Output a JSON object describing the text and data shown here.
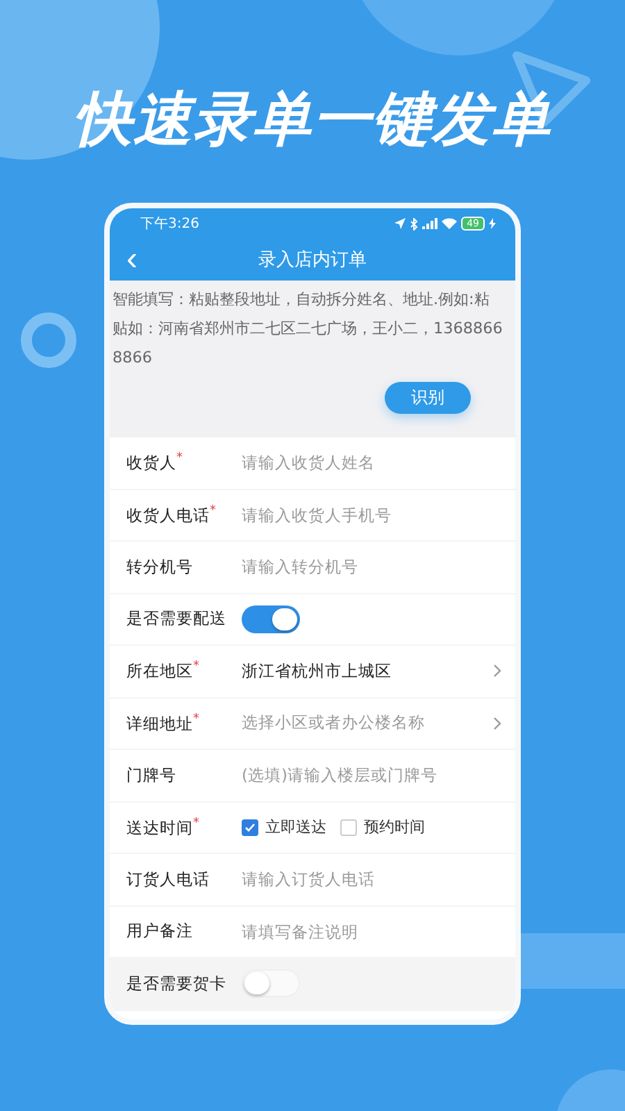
{
  "headline": "快速录单一键发单",
  "status_bar": {
    "time": "下午3:26",
    "battery": "49"
  },
  "nav": {
    "back": "‹",
    "title": "录入店内订单"
  },
  "smart_fill": {
    "text": "智能填写：粘贴整段地址，自动拆分姓名、地址.例如:粘贴如：河南省郑州市二七区二七广场，王小二，13688668866",
    "button": "识别"
  },
  "form": [
    {
      "kind": "input",
      "label": "收货人$^{*}$",
      "placeholder": "请输入收货人姓名"
    },
    {
      "kind": "input",
      "label": "收货人电话$^{*}$",
      "placeholder": "请输入收货人手机号"
    },
    {
      "kind": "input",
      "label": "转分机号",
      "placeholder": "请输入转分机号"
    },
    {
      "kind": "toggle",
      "label": "是否需要配送",
      "on": true
    },
    {
      "kind": "select",
      "label": "所在地区$^{*}$",
      "value": "浙江省杭州市上城区"
    },
    {
      "kind": "select",
      "label": "详细地址$^{*}$",
      "placeholder": "选择小区或者办公楼名称"
    },
    {
      "kind": "input",
      "label": "门牌号",
      "placeholder": "(选填)请输入楼层或门牌号"
    },
    {
      "kind": "checks",
      "label": "送达时间$^{*}$",
      "options": [
        {
          "label": "立即送达",
          "checked": true
        },
        {
          "label": "预约时间",
          "checked": false
        }
      ]
    },
    {
      "kind": "input",
      "label": "订货人电话",
      "placeholder": "请输入订货人电话"
    },
    {
      "kind": "input",
      "label": "用户备注",
      "placeholder": "请填写备注说明"
    },
    {
      "kind": "toggle",
      "label": "是否需要贺卡",
      "on": false
    }
  ]
}
